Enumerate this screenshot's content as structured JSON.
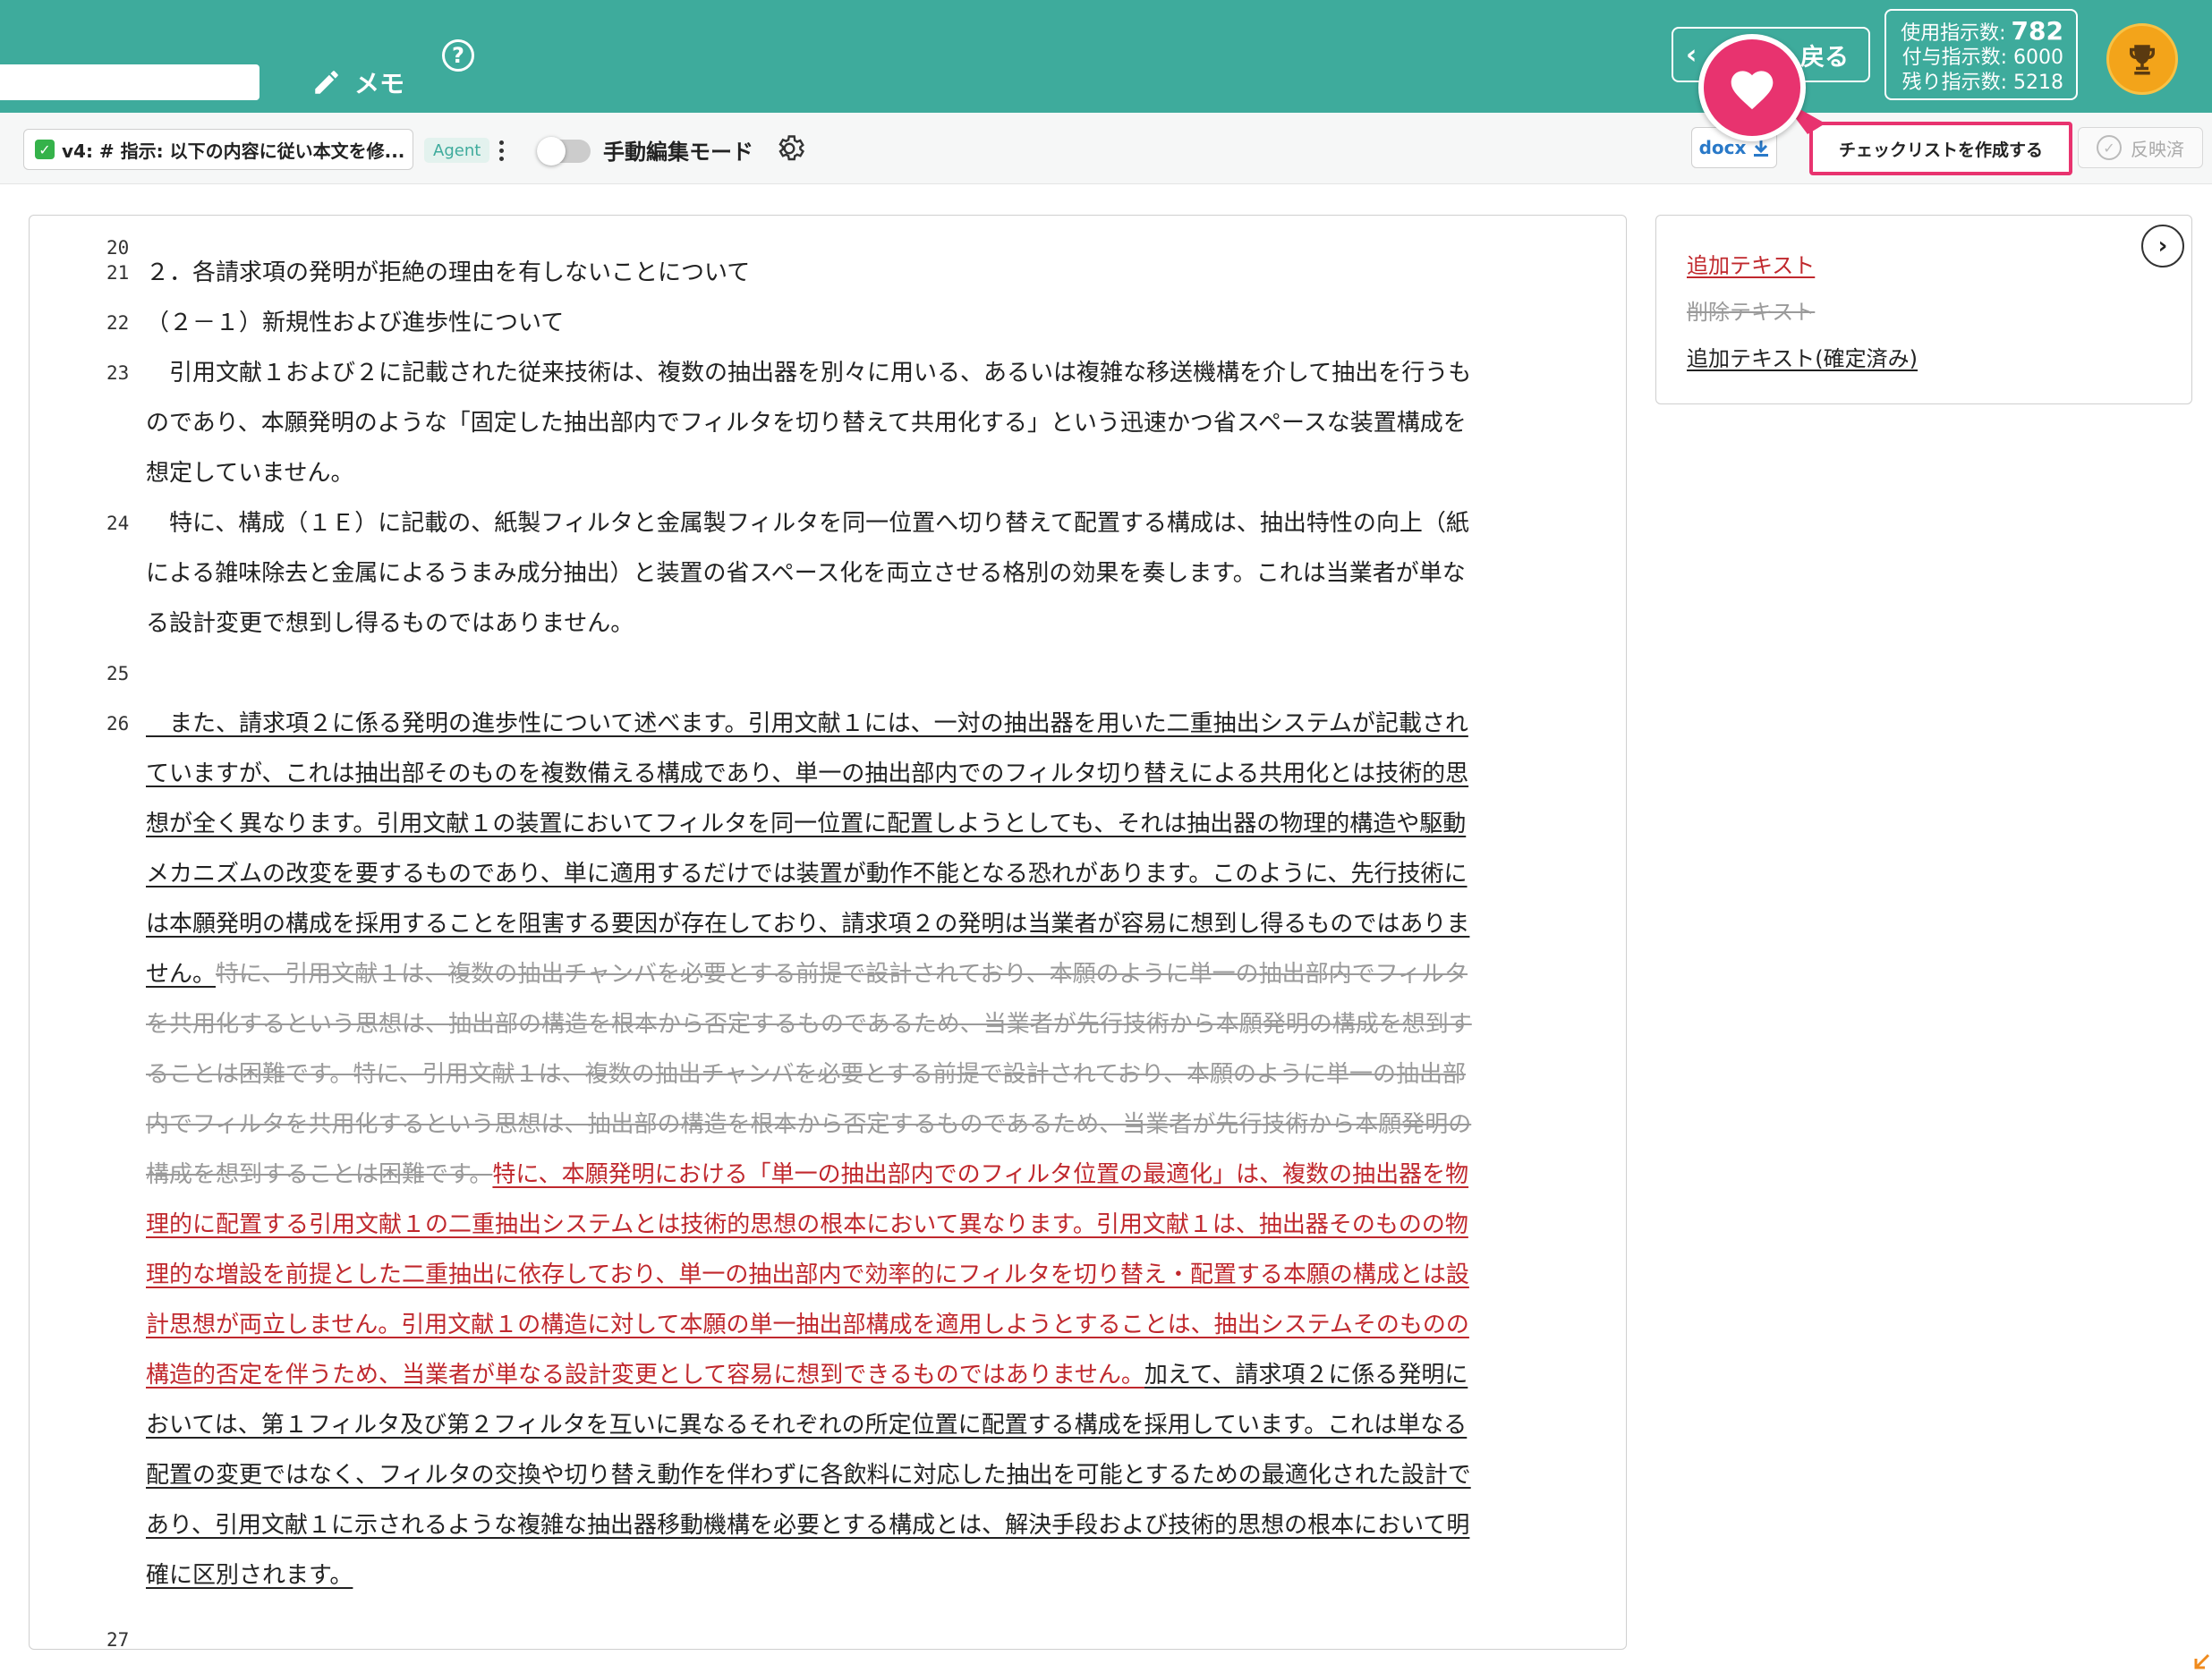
{
  "header": {
    "memo_label": "メモ",
    "help_label": "?",
    "back_label": "戻る",
    "stats": {
      "used_label": "使用指示数:",
      "used_value": "782",
      "granted": "付与指示数: 6000",
      "remaining": "残り指示数: 5218"
    }
  },
  "toolbar": {
    "version_label": "v4: # 指示: 以下の内容に従い本文を修...",
    "agent_label": "Agent",
    "manual_edit_label": "手動編集モード",
    "docx_label": "docx",
    "checklist_label": "チェックリストを作成する",
    "reflected_label": "反映済"
  },
  "legend": {
    "added": "追加テキスト",
    "deleted": "削除テキスト",
    "added_confirmed": "追加テキスト(確定済み)"
  },
  "document": {
    "lines": [
      {
        "no": "20",
        "t": ""
      },
      {
        "no": "21",
        "t": "２．各請求項の発明が拒絶の理由を有しないことについて"
      },
      {
        "no": "22",
        "t": "（２－１）新規性および進歩性について"
      },
      {
        "no": "23",
        "t": "　引用文献１および２に記載された従来技術は、複数の抽出器を別々に用いる、あるいは複雑な移送機構を介して抽出を行うも"
      },
      {
        "no": "",
        "t": "のであり、本願発明のような「固定した抽出部内でフィルタを切り替えて共用化する」という迅速かつ省スペースな装置構成を"
      },
      {
        "no": "",
        "t": "想定していません。"
      },
      {
        "no": "24",
        "t": "　特に、構成（１Ｅ）に記載の、紙製フィルタと金属製フィルタを同一位置へ切り替えて配置する構成は、抽出特性の向上（紙"
      },
      {
        "no": "",
        "t": "による雑味除去と金属によるうまみ成分抽出）と装置の省スペース化を両立させる格別の効果を奏します。これは当業者が単な"
      },
      {
        "no": "",
        "t": "る設計変更で想到し得るものではありません。"
      },
      {
        "no": "25",
        "t": ""
      }
    ],
    "line26_no": "26",
    "p26_ins1": [
      "　また、請求項２に係る発明の進歩性について述べます。引用文献１には、一対の抽出器を用いた二重抽出システムが記載され",
      "ていますが、これは抽出部そのものを複数備える構成であり、単一の抽出部内でのフィルタ切り替えによる共用化とは技術的思",
      "想が全く異なります。引用文献１の装置においてフィルタを同一位置に配置しようとしても、それは抽出器の物理的構造や駆動",
      "メカニズムの改変を要するものであり、単に適用するだけでは装置が動作不能となる恐れがあります。このように、先行技術に",
      "は本願発明の構成を採用することを阻害する要因が存在しており、請求項２の発明は当業者が容易に想到し得るものではありま",
      "せん。"
    ],
    "p26_del": [
      "特に、引用文献１は、複数の抽出チャンバを必要とする前提で設計されており、本願のように単一の抽出部内でフィルタ",
      "を共用化するという思想は、抽出部の構造を根本から否定するものであるため、当業者が先行技術から本願発明の構成を想到す",
      "ることは困難です。特に、引用文献１は、複数の抽出チャンバを必要とする前提で設計されており、本願のように単一の抽出部",
      "内でフィルタを共用化するという思想は、抽出部の構造を根本から否定するものであるため、当業者が先行技術から本願発明の",
      "構成を想到することは困難です。"
    ],
    "p26_add": [
      "特に、本願発明における「単一の抽出部内でのフィルタ位置の最適化」は、複数の抽出器を物",
      "理的に配置する引用文献１の二重抽出システムとは技術的思想の根本において異なります。引用文献１は、抽出器そのものの物",
      "理的な増設を前提とした二重抽出に依存しており、単一の抽出部内で効率的にフィルタを切り替え・配置する本願の構成とは設",
      "計思想が両立しません。引用文献１の構造に対して本願の単一抽出部構成を適用しようとすることは、抽出システムそのものの",
      "構造的否定を伴うため、当業者が単なる設計変更として容易に想到できるものではありません。"
    ],
    "p26_ins2": [
      "加えて、請求項２に係る発明に",
      "おいては、第１フィルタ及び第２フィルタを互いに異なるそれぞれの所定位置に配置する構成を採用しています。これは単なる",
      "配置の変更ではなく、フィルタの交換や切り替え動作を伴わずに各飲料に対応した抽出を可能とするための最適化された設計で",
      "あり、引用文献１に示されるような複雑な抽出器移動機構を必要とする構成とは、解決手段および技術的思想の根本において明",
      "確に区別されます。"
    ],
    "line27_no": "27"
  }
}
